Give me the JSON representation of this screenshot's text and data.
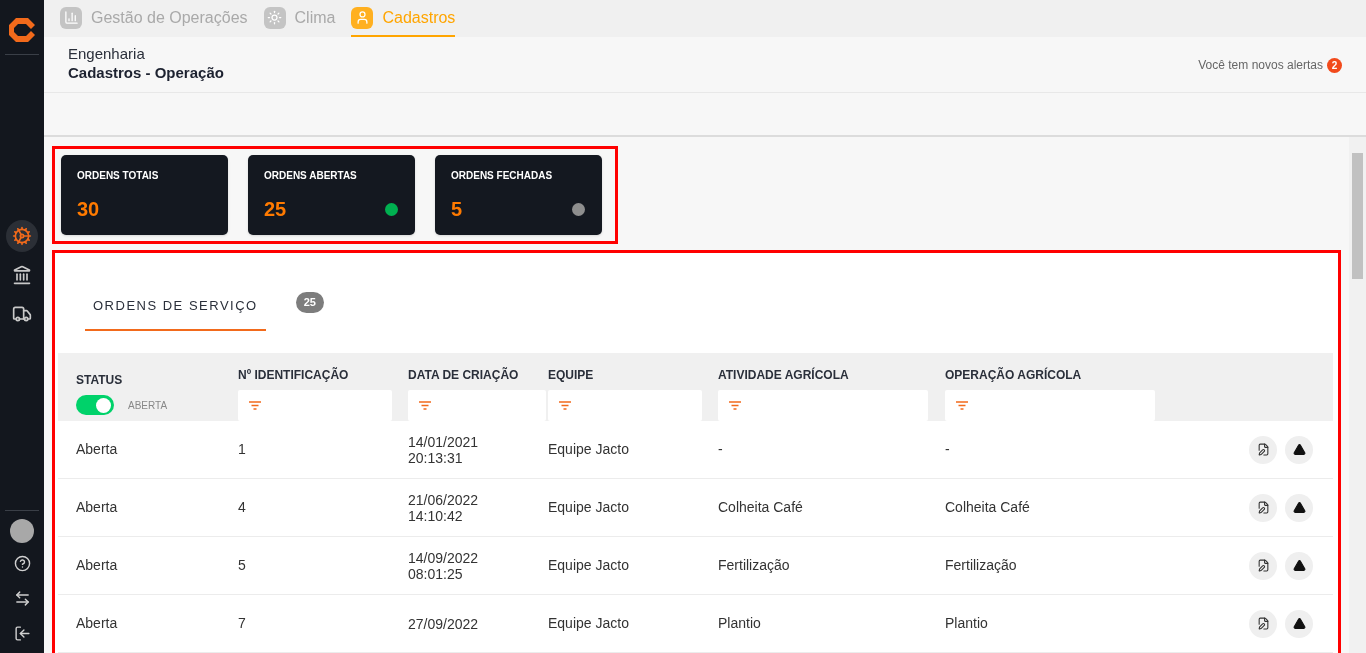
{
  "top_tabs": [
    {
      "label": "Gestão de Operações",
      "kind": "chart",
      "selected": false
    },
    {
      "label": "Clima",
      "kind": "sun",
      "selected": false
    },
    {
      "label": "Cadastros",
      "kind": "user",
      "selected": true
    }
  ],
  "sidebar": {
    "nav_items": [
      {
        "kind": "gear",
        "selected": true
      },
      {
        "kind": "building",
        "selected": false
      },
      {
        "kind": "vehicle",
        "selected": false
      }
    ]
  },
  "breadcrumb": {
    "section": "Engenharia",
    "page": "Cadastros - Operação"
  },
  "alerts": {
    "text": "Você tem novos alertas",
    "count": "2"
  },
  "summary_cards": [
    {
      "label": "ORDENS TOTAIS",
      "value": "30"
    },
    {
      "label": "ORDENS ABERTAS",
      "value": "25",
      "color": "#00b050"
    },
    {
      "label": "ORDENS FECHADAS",
      "value": "5",
      "color": "#8e8e8e"
    }
  ],
  "panel_tabs": [
    {
      "label": "ORDENS DE SERVIÇO",
      "selected": true
    }
  ],
  "panel_count": "25",
  "table": {
    "columns": [
      {
        "label": "STATUS",
        "kind": "toggle",
        "toggle": {
          "on": true,
          "label": "ABERTA"
        }
      },
      {
        "label": "Nº IDENTIFICAÇÃO",
        "kind": "filter"
      },
      {
        "label": "DATA DE CRIAÇÃO",
        "kind": "filter"
      },
      {
        "label": "EQUIPE",
        "kind": "filter"
      },
      {
        "label": "ATIVIDADE AGRÍCOLA",
        "kind": "filter"
      },
      {
        "label": "OPERAÇÃO AGRÍCOLA",
        "kind": "filter"
      }
    ],
    "rows": [
      {
        "status": "Aberta",
        "id": "1",
        "date": "14/01/2021",
        "time": "20:13:31",
        "team": "Equipe Jacto",
        "activity": "-",
        "operation": "-"
      },
      {
        "status": "Aberta",
        "id": "4",
        "date": "21/06/2022",
        "time": "14:10:42",
        "team": "Equipe Jacto",
        "activity": "Colheita Café",
        "operation": "Colheita Café"
      },
      {
        "status": "Aberta",
        "id": "5",
        "date": "14/09/2022",
        "time": "08:01:25",
        "team": "Equipe Jacto",
        "activity": "Fertilização",
        "operation": "Fertilização"
      },
      {
        "status": "Aberta",
        "id": "7",
        "date": "27/09/2022",
        "team": "Equipe Jacto",
        "activity": "Plantio",
        "operation": "Plantio"
      }
    ]
  }
}
